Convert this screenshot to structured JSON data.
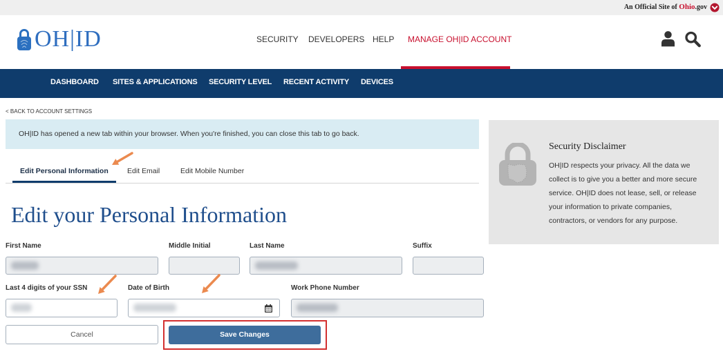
{
  "official_bar": {
    "prefix": "An Official Site of",
    "brand": "Ohio",
    "suffix": ".gov",
    "icon": "chevron-down-circle-icon"
  },
  "logo": {
    "left": "OH",
    "separator": "|",
    "right": "ID",
    "icon": "lock-icon"
  },
  "top_nav": {
    "items": [
      {
        "label": "SECURITY",
        "active": false
      },
      {
        "label": "DEVELOPERS",
        "active": false
      },
      {
        "label": "HELP",
        "active": false
      },
      {
        "label": "MANAGE OH|ID ACCOUNT",
        "active": true
      }
    ]
  },
  "header_icons": {
    "account": "user-icon",
    "search": "search-icon"
  },
  "sub_nav": {
    "items": [
      {
        "label": "DASHBOARD"
      },
      {
        "label": "SITES & APPLICATIONS"
      },
      {
        "label": "SECURITY LEVEL"
      },
      {
        "label": "RECENT ACTIVITY"
      },
      {
        "label": "DEVICES"
      }
    ]
  },
  "back_link": {
    "label": "< BACK TO ACCOUNT SETTINGS"
  },
  "info_message": "OH|ID has opened a new tab within your browser. When you're finished, you can close this tab to go back.",
  "tabs": [
    {
      "label": "Edit Personal Information",
      "active": true
    },
    {
      "label": "Edit Email",
      "active": false
    },
    {
      "label": "Edit Mobile Number",
      "active": false
    }
  ],
  "page_title": "Edit your Personal Information",
  "form": {
    "fields": [
      {
        "label": "First Name",
        "readonly": true,
        "value_blurred": true
      },
      {
        "label": "Middle Initial",
        "readonly": true,
        "value_blurred": false
      },
      {
        "label": "Last Name",
        "readonly": true,
        "value_blurred": true
      },
      {
        "label": "Suffix",
        "readonly": true,
        "value_blurred": false
      },
      {
        "label": "Last 4 digits of your SSN",
        "readonly": false,
        "value_blurred": true
      },
      {
        "label": "Date of Birth",
        "readonly": false,
        "value_blurred": true,
        "icon": "calendar-icon"
      },
      {
        "label": "Work Phone Number",
        "readonly": true,
        "value_blurred": true
      }
    ]
  },
  "buttons": {
    "cancel": "Cancel",
    "save": "Save Changes"
  },
  "disclaimer": {
    "icon": "lock-icon",
    "title": "Security Disclaimer",
    "body_lines": [
      "OH|ID respects your privacy. All the data we",
      "collect is to give you a better and more secure",
      "service. OH|ID does not lease, sell, or release",
      "your information to private companies,",
      "contractors, or vendors for any purpose."
    ]
  },
  "colors": {
    "nav_blue": "#0f3c6c",
    "accent_red": "#c8102e",
    "title_blue": "#1f4e8c",
    "info_bg": "#d9ecf3",
    "save_button": "#3e6d9c",
    "annotation_orange": "#eb8a4f",
    "annotation_red": "#d32f2f"
  }
}
